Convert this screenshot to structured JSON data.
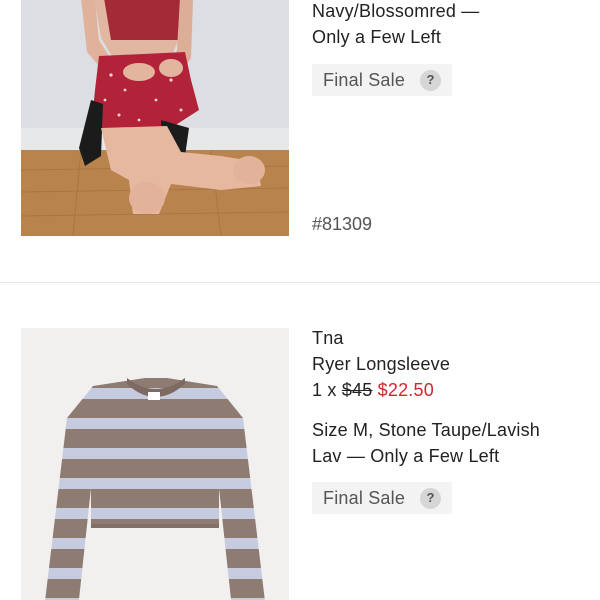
{
  "items": [
    {
      "image_alt": "model-red-floral-skirt",
      "variant_line1": "Navy/Blossomred —",
      "variant_line2": "Only a Few Left",
      "final_sale_label": "Final Sale",
      "help_symbol": "?",
      "sku": "#81309"
    },
    {
      "image_alt": "striped-longsleeve",
      "brand": "Tna",
      "name": "Ryer Longsleeve",
      "quantity_prefix": "1 x ",
      "original_price": "$45",
      "sale_price": "$22.50",
      "variant_line1": "Size M, Stone Taupe/Lavish",
      "variant_line2": "Lav — Only a Few Left",
      "final_sale_label": "Final Sale",
      "help_symbol": "?"
    }
  ],
  "colors": {
    "sale_red": "#d3262b",
    "badge_bg": "#f3f3f3",
    "divider": "#e8e8e8"
  }
}
